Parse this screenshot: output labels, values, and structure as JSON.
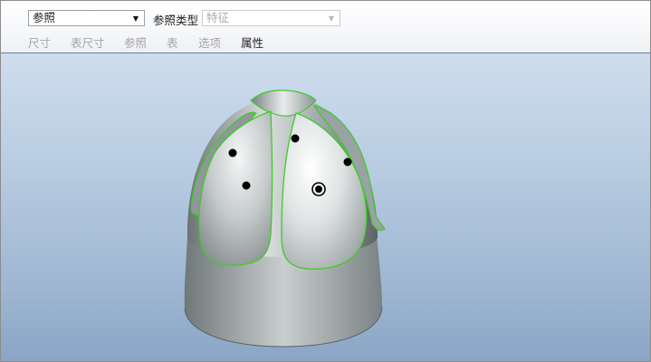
{
  "toolbar": {
    "reference_select": {
      "value": "参照",
      "icon": "chevron-down-icon"
    },
    "reference_type": {
      "label": "参照类型",
      "value": "特征",
      "enabled": false,
      "icon": "chevron-down-icon"
    }
  },
  "tabs": [
    {
      "label": "尺寸",
      "active": false
    },
    {
      "label": "表尺寸",
      "active": false
    },
    {
      "label": "参照",
      "active": false
    },
    {
      "label": "表",
      "active": false
    },
    {
      "label": "选项",
      "active": false
    },
    {
      "label": "属性",
      "active": true
    }
  ],
  "viewport": {
    "model": "dome-shell-part",
    "highlight_color": "#3ecc2a",
    "background_top": "#cfdded",
    "background_bottom": "#8aa5c6",
    "reference_points_count": 5,
    "selected_point_count": 1
  }
}
